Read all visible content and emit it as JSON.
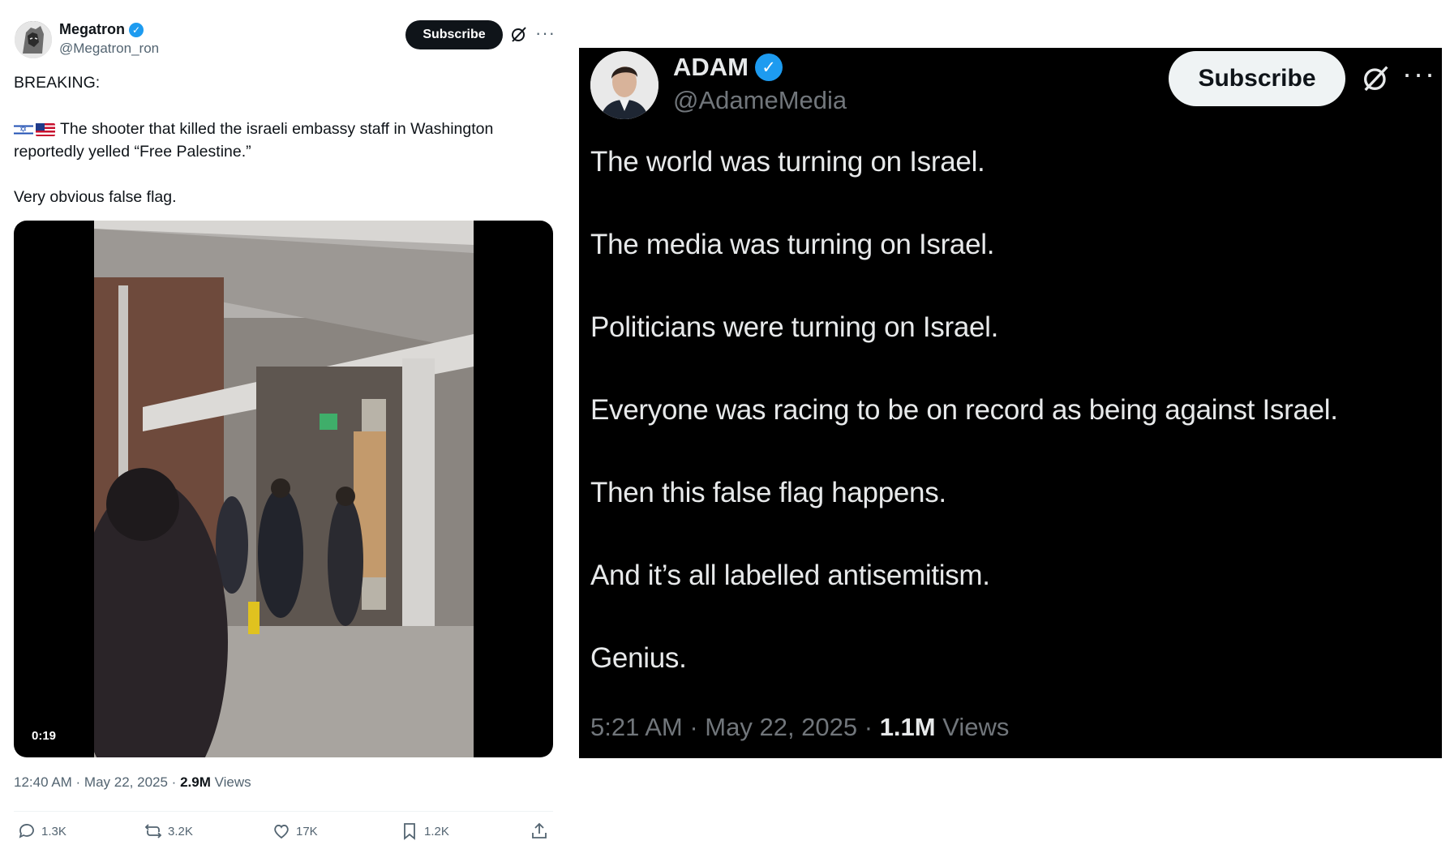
{
  "left_tweet": {
    "author_name": "Megatron",
    "handle": "@Megatron_ron",
    "subscribe_label": "Subscribe",
    "more_label": "···",
    "text_line1": "BREAKING:",
    "text_line2": "The shooter that killed the israeli embassy staff in Washington reportedly yelled “Free Palestine.”",
    "text_line3": "Very obvious false flag.",
    "flags": [
      "israel-flag-icon",
      "us-flag-icon"
    ],
    "video_duration": "0:19",
    "meta_time": "12:40 AM · May 22, 2025 · ",
    "views_count": "2.9M",
    "views_label": " Views",
    "actions": {
      "replies": "1.3K",
      "reposts": "3.2K",
      "likes": "17K",
      "bookmarks": "1.2K"
    }
  },
  "right_tweet": {
    "author_name": "ADAM",
    "handle": "@AdameMedia",
    "subscribe_label": "Subscribe",
    "more_label": "···",
    "lines": [
      "The world was turning on Israel.",
      "The media was turning on Israel.",
      "Politicians were turning on Israel.",
      "Everyone was racing to be on record as being against Israel.",
      "Then this false flag happens.",
      "And it’s all labelled antisemitism.",
      "Genius."
    ],
    "meta_time": "5:21 AM · May 22, 2025 · ",
    "views_count": "1.1M",
    "views_label": " Views"
  },
  "colors": {
    "verified_blue": "#1d9bf0",
    "dark_bg": "#000000",
    "light_bg": "#ffffff",
    "muted_text": "#536471"
  }
}
